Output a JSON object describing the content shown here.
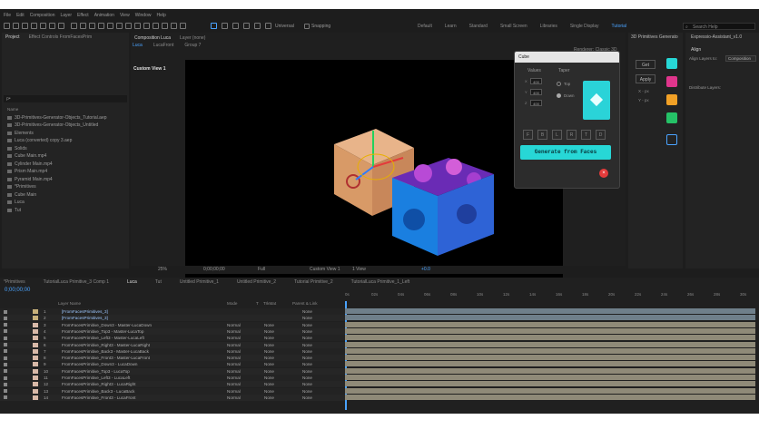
{
  "menu": [
    "File",
    "Edit",
    "Composition",
    "Layer",
    "Effect",
    "Animation",
    "View",
    "Window",
    "Help"
  ],
  "toolbar": {
    "universal": "Universal",
    "snapping": "Snapping"
  },
  "workspaces": [
    "Default",
    "Learn",
    "Standard",
    "Small Screen",
    "Libraries",
    "Single Display",
    "Tutorial"
  ],
  "search_help": "Search Help",
  "project": {
    "tabs": [
      "Project",
      "Effect Controls FromFacesPrim"
    ],
    "search_placeholder": "ρ•",
    "column": "Name",
    "items": [
      "3D-Primitives-Generator-Objects_Tutorial.aep",
      "3D-Primitives-Generator-Objects_Untitled",
      "Elements",
      "Luca (converted) copy 3.aep",
      "Solids",
      "Cube Main.mp4",
      "Cylinder Main.mp4",
      "Prism Main.mp4",
      "Pyramid Main.mp4",
      "*Primitives",
      "Cube Main",
      "Luca",
      "Tut"
    ]
  },
  "composition": {
    "tab": "Composition Luca",
    "layer_tab": "Layer (none)",
    "breadcrumbs": [
      "Luca",
      "LucaFront",
      "Group 7"
    ],
    "renderer_label": "Renderer:",
    "renderer_value": "Classic 3D",
    "view_label": "Custom View 1",
    "zoom": "25%",
    "timecode": "0;00;00;00",
    "resolution": "Full",
    "view_select": "Custom View 1",
    "views": "1 View",
    "exposure": "+0.0"
  },
  "cube_panel": {
    "title": "Cube",
    "values_label": "Values",
    "taper_label": "Taper",
    "x_label": "X",
    "x_value": "400",
    "y_label": "Y",
    "y_value": "400",
    "z_label": "Z",
    "z_value": "400",
    "radio_top": "Top",
    "radio_down": "Down",
    "letters": [
      "F",
      "B",
      "L",
      "R",
      "T",
      "D"
    ],
    "generate_label": "Generate from Faces"
  },
  "right_panels": {
    "primitives_tab": "3D Primitives Generato",
    "expr_tab": "Expressio-Assistant_v1.0",
    "get_label": "Get",
    "apply_label": "Apply",
    "x_px": "X - px",
    "y_px": "Y - px",
    "align": "Align",
    "align_layers_to": "Align Layers to:",
    "align_target": "Composition",
    "distribute": "Distribute Layers:"
  },
  "timeline": {
    "tabs": [
      "*Primitives",
      "TutorialLuca Primitive_3 Comp 1",
      "Luca",
      "Tut",
      "Untitled Primitive_1",
      "Untitled Primitive_2",
      "Tutorial Primitive_2",
      "TutorialLuca Primitive_1_Left"
    ],
    "timecode": "0;00;00;00",
    "columns": {
      "layer_name": "Layer Name",
      "mode": "Mode",
      "t": "T",
      "trkmat": "TrkMat",
      "parent": "Parent & Link"
    },
    "ruler": [
      "0s",
      "02s",
      "04s",
      "06s",
      "08s",
      "10s",
      "12s",
      "14s",
      "16s",
      "18s",
      "20s",
      "22s",
      "24s",
      "26s",
      "28s",
      "30s"
    ],
    "rows": [
      {
        "num": "1",
        "name": "[FromFacesPrimitives_3]",
        "mode": "",
        "trk": "",
        "parent": "None"
      },
      {
        "num": "2",
        "name": "[FromFacesPrimitives_3]",
        "mode": "",
        "trk": "",
        "parent": "None"
      },
      {
        "num": "3",
        "name": "FromFacesPrimitive_Down3 - Master-LucaDown",
        "mode": "Normal",
        "trk": "None",
        "parent": "None"
      },
      {
        "num": "4",
        "name": "FromFacesPrimitive_Top3 - Master-LucaTop",
        "mode": "Normal",
        "trk": "None",
        "parent": "None"
      },
      {
        "num": "5",
        "name": "FromFacesPrimitive_Left3 - Master-LucaLeft",
        "mode": "Normal",
        "trk": "None",
        "parent": "None"
      },
      {
        "num": "6",
        "name": "FromFacesPrimitive_Right3 - Master-LucaRight",
        "mode": "Normal",
        "trk": "None",
        "parent": "None"
      },
      {
        "num": "7",
        "name": "FromFacesPrimitive_Back3 - Master-LucaBack",
        "mode": "Normal",
        "trk": "None",
        "parent": "None"
      },
      {
        "num": "8",
        "name": "FromFacesPrimitive_Front3 - Master-LucaFront",
        "mode": "Normal",
        "trk": "None",
        "parent": "None"
      },
      {
        "num": "9",
        "name": "FromFacesPrimitive_Down3 - LucaDown",
        "mode": "Normal",
        "trk": "None",
        "parent": "None"
      },
      {
        "num": "10",
        "name": "FromFacesPrimitive_Top3 - LucaTop",
        "mode": "Normal",
        "trk": "None",
        "parent": "None"
      },
      {
        "num": "11",
        "name": "FromFacesPrimitive_Left3 - LucaLeft",
        "mode": "Normal",
        "trk": "None",
        "parent": "None"
      },
      {
        "num": "12",
        "name": "FromFacesPrimitive_Right3 - LucaRight",
        "mode": "Normal",
        "trk": "None",
        "parent": "None"
      },
      {
        "num": "13",
        "name": "FromFacesPrimitive_Back3 - LucaBack",
        "mode": "Normal",
        "trk": "None",
        "parent": "None"
      },
      {
        "num": "14",
        "name": "FromFacesPrimitive_Front3 - LucaFront",
        "mode": "Normal",
        "trk": "None",
        "parent": "None"
      }
    ]
  },
  "colors": {
    "accent": "#4aa3ff",
    "cyan": "#27d7d6",
    "red": "#e33b3b",
    "green": "#25c267",
    "orange": "#f2a126",
    "pink": "#e0358c",
    "track": "#8f8a78"
  }
}
